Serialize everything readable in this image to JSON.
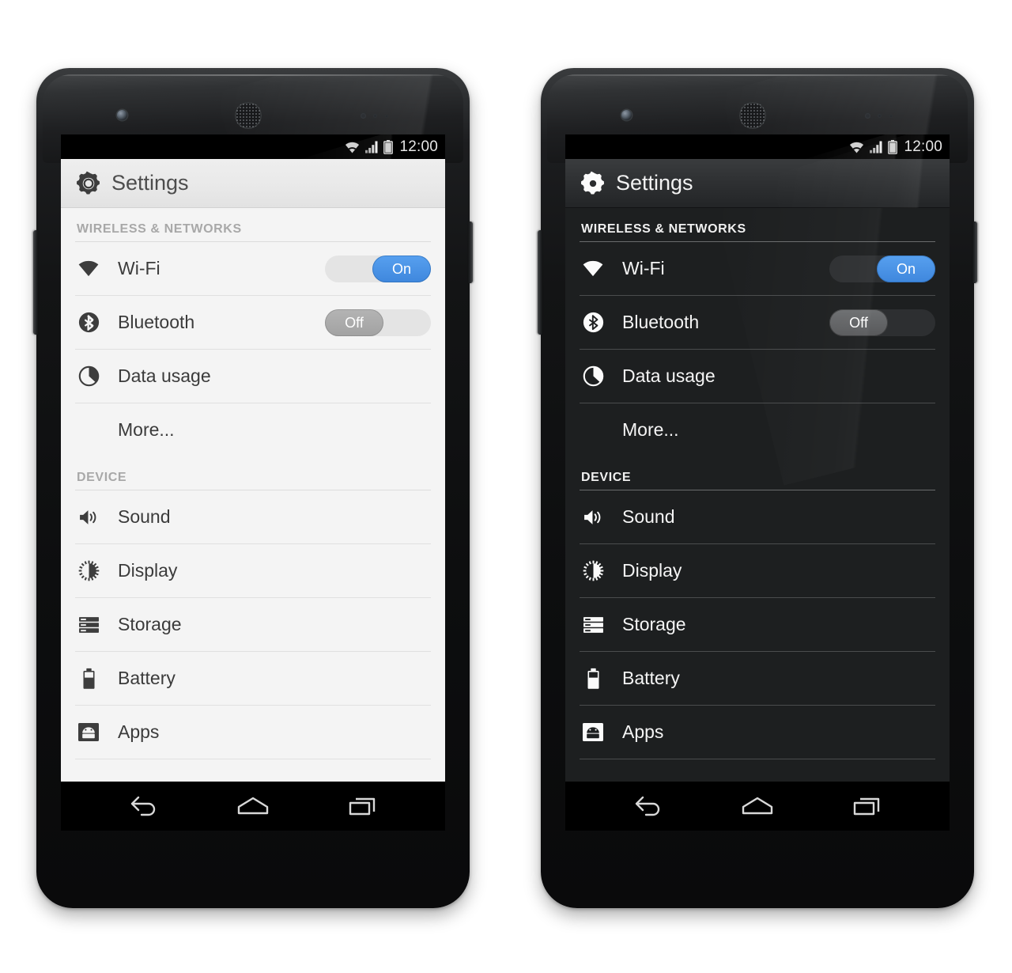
{
  "page": {
    "description": "Two Nexus-style phones showing Android Settings in light theme (left) and dark theme (right)"
  },
  "colors": {
    "accent_on": "#4A90E2",
    "switch_off_light": "#ABABAB",
    "switch_off_dark": "#64666A",
    "track_light": "#E4E4E4",
    "track_dark": "#2D2F31",
    "light_bg": "#F4F4F4",
    "dark_bg": "#1D1F20",
    "light_text": "#3B3B3B",
    "dark_text": "#F5F5F5",
    "section_label_light": "#A8A8A8",
    "section_label_dark": "#F0F0F0"
  },
  "status_bar": {
    "clock": "12:00",
    "icons": [
      "wifi-icon",
      "cellular-signal-icon",
      "battery-icon"
    ]
  },
  "action_bar": {
    "icon": "settings-gear-icon",
    "title": "Settings"
  },
  "sections": [
    {
      "label": "WIRELESS & NETWORKS",
      "rows": [
        {
          "icon": "wifi-icon",
          "label": "Wi-Fi",
          "control": "switch",
          "state": "on",
          "state_label": "On"
        },
        {
          "icon": "bluetooth-icon",
          "label": "Bluetooth",
          "control": "switch",
          "state": "off",
          "state_label": "Off"
        },
        {
          "icon": "data-usage-icon",
          "label": "Data usage",
          "control": "none"
        },
        {
          "icon": "none",
          "label": "More...",
          "control": "none",
          "indent": true
        }
      ]
    },
    {
      "label": "DEVICE",
      "rows": [
        {
          "icon": "sound-speaker-icon",
          "label": "Sound",
          "control": "none"
        },
        {
          "icon": "display-brightness-icon",
          "label": "Display",
          "control": "none"
        },
        {
          "icon": "storage-icon",
          "label": "Storage",
          "control": "none"
        },
        {
          "icon": "battery-icon",
          "label": "Battery",
          "control": "none"
        },
        {
          "icon": "android-apps-icon",
          "label": "Apps",
          "control": "none"
        }
      ]
    }
  ],
  "nav_bar": {
    "buttons": [
      {
        "name": "back-button",
        "icon": "back-arrow-icon"
      },
      {
        "name": "home-button",
        "icon": "home-icon"
      },
      {
        "name": "recents-button",
        "icon": "recents-icon"
      }
    ]
  },
  "themes": [
    {
      "id": "light",
      "name": "Light theme"
    },
    {
      "id": "dark",
      "name": "Dark theme"
    }
  ]
}
